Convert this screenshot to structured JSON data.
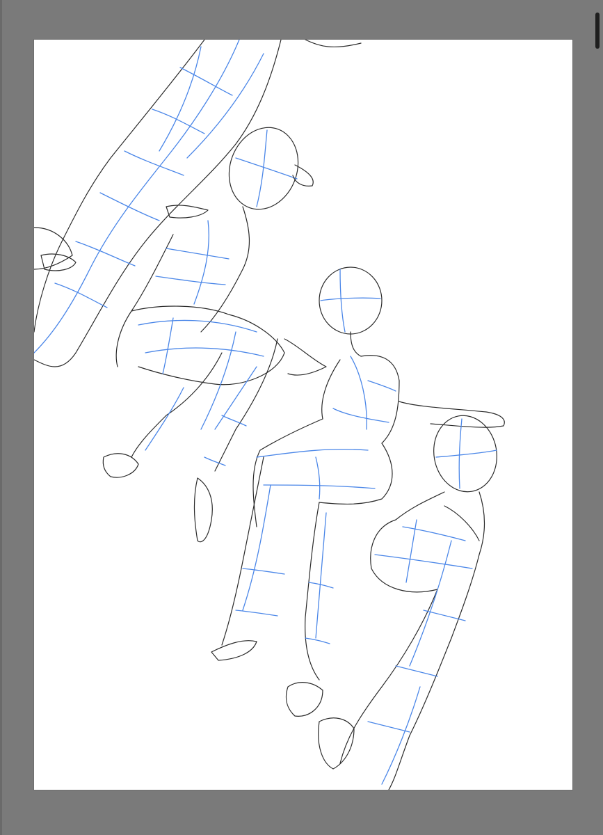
{
  "app": {
    "view": "drawing-canvas",
    "canvas_background": "#ffffff",
    "workspace_background": "#7a7a7a",
    "guide_line_color": "#4a86e8",
    "outline_color": "#2a2a2a"
  },
  "canvas": {
    "content": "pose-reference-sketch",
    "figures": [
      "figure-top-left",
      "figure-middle",
      "figure-right-sitting",
      "figure-bottom-right"
    ]
  },
  "scrollbar": {
    "orientation": "vertical"
  }
}
